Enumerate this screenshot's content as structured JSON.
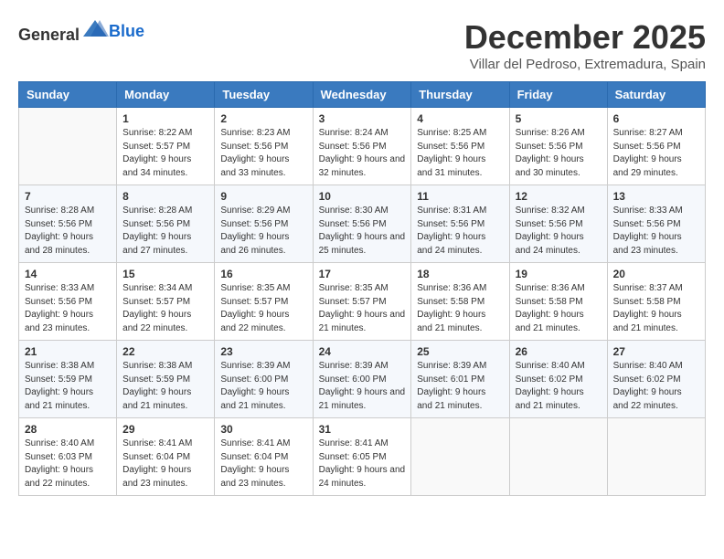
{
  "logo": {
    "text_general": "General",
    "text_blue": "Blue"
  },
  "title": "December 2025",
  "location": "Villar del Pedroso, Extremadura, Spain",
  "days_of_week": [
    "Sunday",
    "Monday",
    "Tuesday",
    "Wednesday",
    "Thursday",
    "Friday",
    "Saturday"
  ],
  "weeks": [
    [
      {
        "day": "",
        "sunrise": "",
        "sunset": "",
        "daylight": ""
      },
      {
        "day": "1",
        "sunrise": "Sunrise: 8:22 AM",
        "sunset": "Sunset: 5:57 PM",
        "daylight": "Daylight: 9 hours and 34 minutes."
      },
      {
        "day": "2",
        "sunrise": "Sunrise: 8:23 AM",
        "sunset": "Sunset: 5:56 PM",
        "daylight": "Daylight: 9 hours and 33 minutes."
      },
      {
        "day": "3",
        "sunrise": "Sunrise: 8:24 AM",
        "sunset": "Sunset: 5:56 PM",
        "daylight": "Daylight: 9 hours and 32 minutes."
      },
      {
        "day": "4",
        "sunrise": "Sunrise: 8:25 AM",
        "sunset": "Sunset: 5:56 PM",
        "daylight": "Daylight: 9 hours and 31 minutes."
      },
      {
        "day": "5",
        "sunrise": "Sunrise: 8:26 AM",
        "sunset": "Sunset: 5:56 PM",
        "daylight": "Daylight: 9 hours and 30 minutes."
      },
      {
        "day": "6",
        "sunrise": "Sunrise: 8:27 AM",
        "sunset": "Sunset: 5:56 PM",
        "daylight": "Daylight: 9 hours and 29 minutes."
      }
    ],
    [
      {
        "day": "7",
        "sunrise": "Sunrise: 8:28 AM",
        "sunset": "Sunset: 5:56 PM",
        "daylight": "Daylight: 9 hours and 28 minutes."
      },
      {
        "day": "8",
        "sunrise": "Sunrise: 8:28 AM",
        "sunset": "Sunset: 5:56 PM",
        "daylight": "Daylight: 9 hours and 27 minutes."
      },
      {
        "day": "9",
        "sunrise": "Sunrise: 8:29 AM",
        "sunset": "Sunset: 5:56 PM",
        "daylight": "Daylight: 9 hours and 26 minutes."
      },
      {
        "day": "10",
        "sunrise": "Sunrise: 8:30 AM",
        "sunset": "Sunset: 5:56 PM",
        "daylight": "Daylight: 9 hours and 25 minutes."
      },
      {
        "day": "11",
        "sunrise": "Sunrise: 8:31 AM",
        "sunset": "Sunset: 5:56 PM",
        "daylight": "Daylight: 9 hours and 24 minutes."
      },
      {
        "day": "12",
        "sunrise": "Sunrise: 8:32 AM",
        "sunset": "Sunset: 5:56 PM",
        "daylight": "Daylight: 9 hours and 24 minutes."
      },
      {
        "day": "13",
        "sunrise": "Sunrise: 8:33 AM",
        "sunset": "Sunset: 5:56 PM",
        "daylight": "Daylight: 9 hours and 23 minutes."
      }
    ],
    [
      {
        "day": "14",
        "sunrise": "Sunrise: 8:33 AM",
        "sunset": "Sunset: 5:56 PM",
        "daylight": "Daylight: 9 hours and 23 minutes."
      },
      {
        "day": "15",
        "sunrise": "Sunrise: 8:34 AM",
        "sunset": "Sunset: 5:57 PM",
        "daylight": "Daylight: 9 hours and 22 minutes."
      },
      {
        "day": "16",
        "sunrise": "Sunrise: 8:35 AM",
        "sunset": "Sunset: 5:57 PM",
        "daylight": "Daylight: 9 hours and 22 minutes."
      },
      {
        "day": "17",
        "sunrise": "Sunrise: 8:35 AM",
        "sunset": "Sunset: 5:57 PM",
        "daylight": "Daylight: 9 hours and 21 minutes."
      },
      {
        "day": "18",
        "sunrise": "Sunrise: 8:36 AM",
        "sunset": "Sunset: 5:58 PM",
        "daylight": "Daylight: 9 hours and 21 minutes."
      },
      {
        "day": "19",
        "sunrise": "Sunrise: 8:36 AM",
        "sunset": "Sunset: 5:58 PM",
        "daylight": "Daylight: 9 hours and 21 minutes."
      },
      {
        "day": "20",
        "sunrise": "Sunrise: 8:37 AM",
        "sunset": "Sunset: 5:58 PM",
        "daylight": "Daylight: 9 hours and 21 minutes."
      }
    ],
    [
      {
        "day": "21",
        "sunrise": "Sunrise: 8:38 AM",
        "sunset": "Sunset: 5:59 PM",
        "daylight": "Daylight: 9 hours and 21 minutes."
      },
      {
        "day": "22",
        "sunrise": "Sunrise: 8:38 AM",
        "sunset": "Sunset: 5:59 PM",
        "daylight": "Daylight: 9 hours and 21 minutes."
      },
      {
        "day": "23",
        "sunrise": "Sunrise: 8:39 AM",
        "sunset": "Sunset: 6:00 PM",
        "daylight": "Daylight: 9 hours and 21 minutes."
      },
      {
        "day": "24",
        "sunrise": "Sunrise: 8:39 AM",
        "sunset": "Sunset: 6:00 PM",
        "daylight": "Daylight: 9 hours and 21 minutes."
      },
      {
        "day": "25",
        "sunrise": "Sunrise: 8:39 AM",
        "sunset": "Sunset: 6:01 PM",
        "daylight": "Daylight: 9 hours and 21 minutes."
      },
      {
        "day": "26",
        "sunrise": "Sunrise: 8:40 AM",
        "sunset": "Sunset: 6:02 PM",
        "daylight": "Daylight: 9 hours and 21 minutes."
      },
      {
        "day": "27",
        "sunrise": "Sunrise: 8:40 AM",
        "sunset": "Sunset: 6:02 PM",
        "daylight": "Daylight: 9 hours and 22 minutes."
      }
    ],
    [
      {
        "day": "28",
        "sunrise": "Sunrise: 8:40 AM",
        "sunset": "Sunset: 6:03 PM",
        "daylight": "Daylight: 9 hours and 22 minutes."
      },
      {
        "day": "29",
        "sunrise": "Sunrise: 8:41 AM",
        "sunset": "Sunset: 6:04 PM",
        "daylight": "Daylight: 9 hours and 23 minutes."
      },
      {
        "day": "30",
        "sunrise": "Sunrise: 8:41 AM",
        "sunset": "Sunset: 6:04 PM",
        "daylight": "Daylight: 9 hours and 23 minutes."
      },
      {
        "day": "31",
        "sunrise": "Sunrise: 8:41 AM",
        "sunset": "Sunset: 6:05 PM",
        "daylight": "Daylight: 9 hours and 24 minutes."
      },
      {
        "day": "",
        "sunrise": "",
        "sunset": "",
        "daylight": ""
      },
      {
        "day": "",
        "sunrise": "",
        "sunset": "",
        "daylight": ""
      },
      {
        "day": "",
        "sunrise": "",
        "sunset": "",
        "daylight": ""
      }
    ]
  ]
}
